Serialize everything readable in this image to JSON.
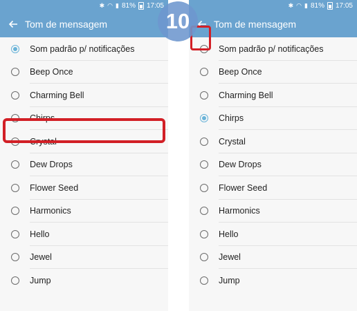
{
  "left_panel": {
    "status": {
      "battery_text": "81%",
      "time": "17:05"
    },
    "title": "Tom de mensagem",
    "selected_index": 0,
    "items": [
      "Som padrão p/ notificações",
      "Beep Once",
      "Charming Bell",
      "Chirps",
      "Crystal",
      "Dew Drops",
      "Flower Seed",
      "Harmonics",
      "Hello",
      "Jewel",
      "Jump"
    ]
  },
  "right_panel": {
    "status": {
      "battery_text": "81%",
      "time": "17:05"
    },
    "title": "Tom de mensagem",
    "selected_index": 3,
    "items": [
      "Som padrão p/ notificações",
      "Beep Once",
      "Charming Bell",
      "Chirps",
      "Crystal",
      "Dew Drops",
      "Flower Seed",
      "Harmonics",
      "Hello",
      "Jewel",
      "Jump"
    ]
  },
  "step_badge": "10",
  "colors": {
    "app_bar": "#6aa3cf",
    "radio_selected": "#69b3d8",
    "highlight": "#d21f26",
    "badge": "#6e97cf"
  },
  "icons": {
    "back": "arrow-left-icon",
    "bluetooth": "bluetooth-icon",
    "wifi": "wifi-icon",
    "signal": "signal-icon",
    "battery": "battery-icon"
  }
}
